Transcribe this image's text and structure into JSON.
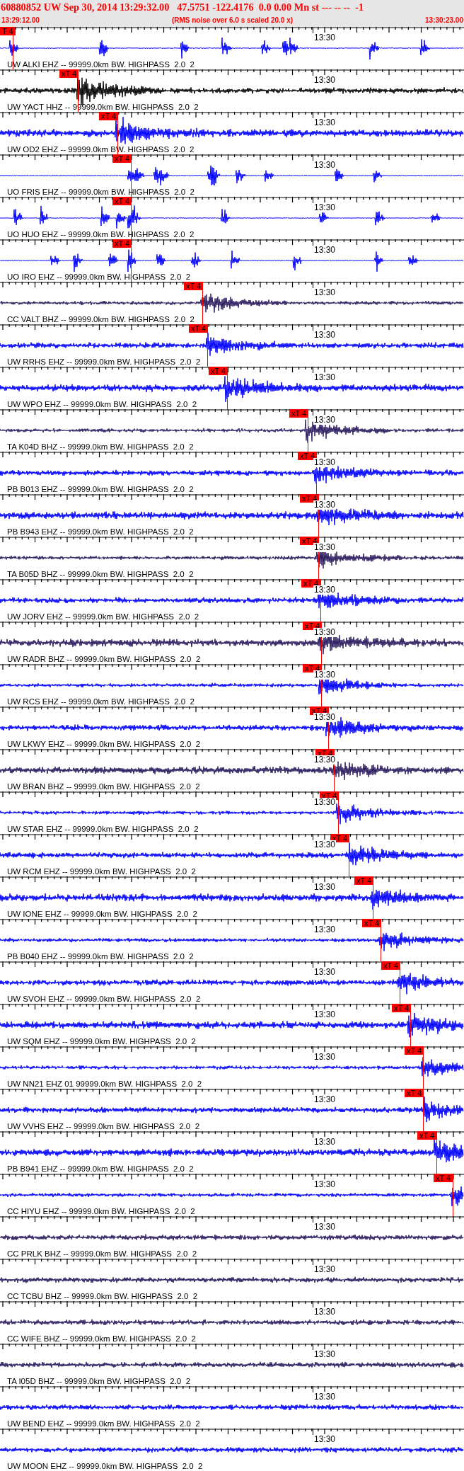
{
  "header": {
    "title": "60880852 UW Sep 30, 2014 13:29:32.00   47.5751 -122.4176  0.0 0.00 Mn st --- -- --  -1",
    "start_time": "13:29:12.00",
    "note": "(RMS noise over 6.0 s scaled 20.0 x)",
    "end_time": "13:30:23.00"
  },
  "traces": [
    {
      "label": "UW ALKI EHZ -- 99999.0km BW. HIGHPASS  2.0  2",
      "tick_label": "13:30",
      "kind": "spiky",
      "color": "#0000ff",
      "pick": {
        "label": "T 4",
        "level": 0.027
      }
    },
    {
      "label": "UW YACT HHZ -- 99999.0km BW. HIGHPASS  2.0  2",
      "tick_label": "13:30",
      "kind": "quake",
      "color": "#000000",
      "pick": {
        "label": "xT 4",
        "level": 0.168
      }
    },
    {
      "label": "UW OD2 EHZ -- 99999.0km BW. HIGHPASS  2.0  2",
      "tick_label": "13:30",
      "kind": "quake",
      "color": "#0000ff",
      "pick": {
        "label": "xT 4",
        "level": 0.253
      }
    },
    {
      "label": "UO FRIS EHZ -- 99999.0km BW. HIGHPASS  2.0  2",
      "tick_label": "13:30",
      "kind": "spiky",
      "color": "#0000ff",
      "pick": {
        "label": "xT 4",
        "level": 0.282
      }
    },
    {
      "label": "UO HUO EHZ -- 99999.0km BW. HIGHPASS  2.0  2",
      "tick_label": "13:30",
      "kind": "spiky",
      "color": "#0000ff",
      "pick": {
        "label": "xT 4",
        "level": 0.282
      }
    },
    {
      "label": "UO IRO EHZ -- 99999.0km BW. HIGHPASS  2.0  2",
      "tick_label": "13:30",
      "kind": "spiky",
      "color": "#0000ff",
      "pick": {
        "label": "xT 4",
        "level": 0.282
      }
    },
    {
      "label": "CC VALT BHZ -- 99999.0km BW. HIGHPASS  2.0  2",
      "tick_label": "13:30",
      "kind": "quake",
      "color": "#2a1a5e",
      "pick": {
        "label": "xT 4",
        "level": 0.436
      }
    },
    {
      "label": "UW RRHS EHZ -- 99999.0km BW. HIGHPASS  2.0  2",
      "tick_label": "13:30",
      "kind": "quake",
      "color": "#0000ff",
      "pick": {
        "label": "xT 4",
        "level": 0.447
      }
    },
    {
      "label": "UW WPO EHZ -- 99999.0km BW. HIGHPASS  2.0  2",
      "tick_label": "13:30",
      "kind": "quake",
      "color": "#0000ff",
      "pick": {
        "label": "xT 4",
        "level": 0.489
      }
    },
    {
      "label": "TA K04D BHZ -- 99999.0km BW. HIGHPASS  2.0  2",
      "tick_label": "13:30",
      "kind": "quake",
      "color": "#2a1a5e",
      "pick": {
        "label": "xT 4",
        "level": 0.663
      }
    },
    {
      "label": "PB B013 EHZ -- 99999.0km BW. HIGHPASS  2.0  2",
      "tick_label": "13:30",
      "kind": "quake",
      "color": "#0000ff",
      "pick": {
        "label": "xT 4",
        "level": 0.681
      }
    },
    {
      "label": "PB B943 EHZ -- 99999.0km BW. HIGHPASS  2.0  2",
      "tick_label": "13:30",
      "kind": "quake",
      "color": "#0000ff",
      "pick": {
        "label": "xT 4",
        "level": 0.686
      }
    },
    {
      "label": "TA B05D BHZ -- 99999.0km BW. HIGHPASS  2.0  2",
      "tick_label": "13:30",
      "kind": "quake",
      "color": "#2a1a5e",
      "pick": {
        "label": "xT 4",
        "level": 0.686
      }
    },
    {
      "label": "UW JORV EHZ -- 99999.0km BW. HIGHPASS  2.0  2",
      "tick_label": "13:30",
      "kind": "quake",
      "color": "#0000ff",
      "pick": {
        "label": "xT 4",
        "level": 0.69
      }
    },
    {
      "label": "UW RADR BHZ -- 99999.0km BW. HIGHPASS  2.0  2",
      "tick_label": "13:30",
      "kind": "quake",
      "color": "#2a1a5e",
      "pick": {
        "label": "xT 4",
        "level": 0.692
      }
    },
    {
      "label": "UW RCS EHZ -- 99999.0km BW. HIGHPASS  2.0  2",
      "tick_label": "13:30",
      "kind": "quake",
      "color": "#0000ff",
      "pick": {
        "label": "xT 4",
        "level": 0.692
      }
    },
    {
      "label": "UW LKWY EHZ -- 99999.0km BW. HIGHPASS  2.0  2",
      "tick_label": "13:30",
      "kind": "quake",
      "color": "#0000ff",
      "pick": {
        "label": "xT 4",
        "level": 0.707
      }
    },
    {
      "label": "UW BRAN BHZ -- 99999.0km BW. HIGHPASS  2.0  2",
      "tick_label": "13:30",
      "kind": "quake",
      "color": "#2a1a5e",
      "pick": {
        "label": "xT 4",
        "level": 0.72
      }
    },
    {
      "label": "UW STAR EHZ -- 99999.0km BW. HIGHPASS  2.0  2",
      "tick_label": "13:30",
      "kind": "quake",
      "color": "#0000ff",
      "pick": {
        "label": "xT 4",
        "level": 0.729
      }
    },
    {
      "label": "UW RCM EHZ -- 99999.0km BW. HIGHPASS  2.0  2",
      "tick_label": "13:30",
      "kind": "quake",
      "color": "#0000ff",
      "pick": {
        "label": "xT 4",
        "level": 0.752
      }
    },
    {
      "label": "UW IONE EHZ -- 99999.0km BW. HIGHPASS  2.0  2",
      "tick_label": "13:30",
      "kind": "quake",
      "color": "#0000ff",
      "pick": {
        "label": "xT 4",
        "level": 0.803
      }
    },
    {
      "label": "PB B040 EHZ -- 99999.0km BW. HIGHPASS  2.0  2",
      "tick_label": "13:30",
      "kind": "quake",
      "color": "#0000ff",
      "pick": {
        "label": "xT 4",
        "level": 0.82
      }
    },
    {
      "label": "UW SVOH EHZ -- 99999.0km BW. HIGHPASS  2.0  2",
      "tick_label": "13:30",
      "kind": "quake",
      "color": "#0000ff",
      "pick": {
        "label": "xT 4",
        "level": 0.861
      }
    },
    {
      "label": "UW SQM EHZ -- 99999.0km BW. HIGHPASS  2.0  2",
      "tick_label": "13:30",
      "kind": "quake",
      "color": "#0000ff",
      "pick": {
        "label": "xT 4",
        "level": 0.884
      }
    },
    {
      "label": "UW NN21 EHZ 01 99999.0km BW. HIGHPASS  2.0  2",
      "tick_label": "13:30",
      "kind": "quake",
      "color": "#0000ff",
      "pick": {
        "label": "xT 4",
        "level": 0.912
      }
    },
    {
      "label": "UW VVHS EHZ -- 99999.0km BW. HIGHPASS  2.0  2",
      "tick_label": "13:30",
      "kind": "quake",
      "color": "#0000ff",
      "pick": {
        "label": "xT 4",
        "level": 0.912
      }
    },
    {
      "label": "PB B941 EHZ -- 99999.0km BW. HIGHPASS  2.0  2",
      "tick_label": "13:30",
      "kind": "quake",
      "color": "#0000ff",
      "pick": {
        "label": "xT 4",
        "level": 0.94
      }
    },
    {
      "label": "CC HIYU EHZ -- 99999.0km BW. HIGHPASS  2.0  2",
      "tick_label": "13:30",
      "kind": "quake",
      "color": "#0000ff",
      "pick": {
        "label": "xT 4",
        "level": 0.975
      }
    },
    {
      "label": "CC PRLK BHZ -- 99999.0km BW. HIGHPASS  2.0  2",
      "tick_label": "13:30",
      "kind": "noise",
      "color": "#2a1a5e"
    },
    {
      "label": "CC TCBU BHZ -- 99999.0km BW. HIGHPASS  2.0  2",
      "tick_label": "13:30",
      "kind": "noise",
      "color": "#2a1a5e"
    },
    {
      "label": "CC WIFE BHZ -- 99999.0km BW. HIGHPASS  2.0  2",
      "tick_label": "13:30",
      "kind": "noise",
      "color": "#2a1a5e"
    },
    {
      "label": "TA I05D BHZ -- 99999.0km BW. HIGHPASS  2.0  2",
      "tick_label": "13:30",
      "kind": "noise",
      "color": "#2a1a5e"
    },
    {
      "label": "UW BEND EHZ -- 99999.0km BW. HIGHPASS  2.0  2",
      "tick_label": "13:30",
      "kind": "noise",
      "color": "#0000ff"
    },
    {
      "label": "UW MOON EHZ -- 99999.0km BW. HIGHPASS  2.0  2",
      "tick_label": "13:30",
      "kind": "noise",
      "color": "#0000ff"
    }
  ]
}
